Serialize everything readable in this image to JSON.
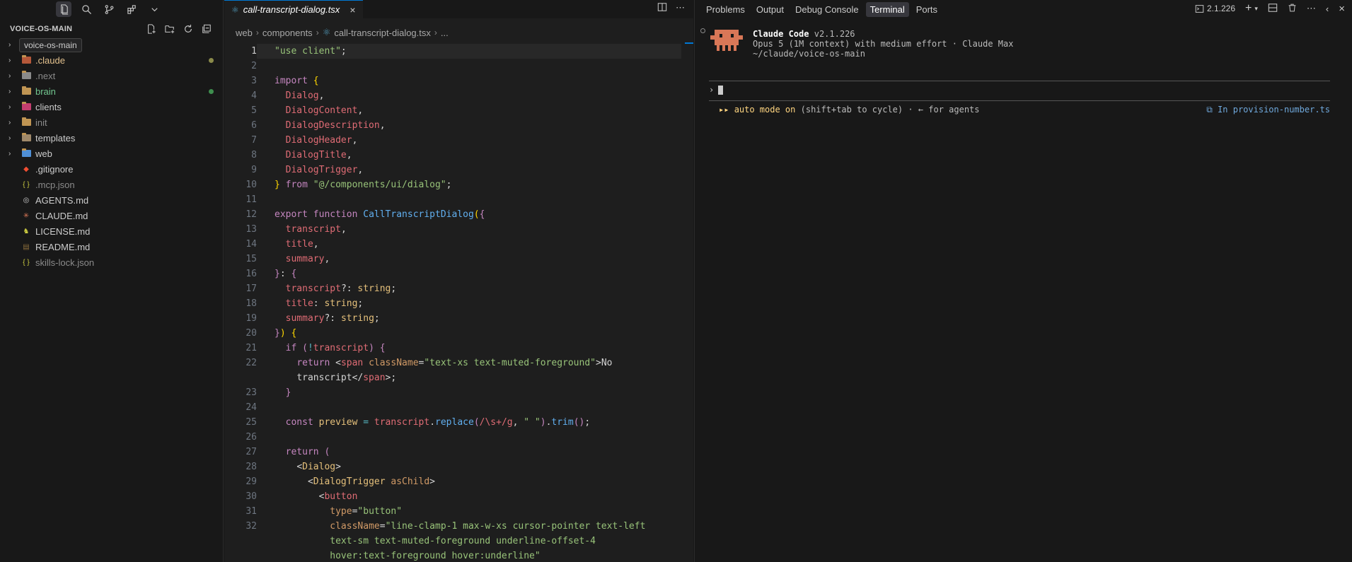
{
  "sidebar": {
    "title": "VOICE-OS-MAIN",
    "tooltip": "voice-os-main",
    "items": [
      {
        "label": "",
        "color": "#cccccc",
        "type": "folder",
        "icon": "folder-icon"
      },
      {
        "label": ".claude",
        "color": "#e2c08d",
        "type": "folder",
        "icon": "claude-folder-icon",
        "dot": "#8a8a4a"
      },
      {
        "label": ".next",
        "color": "#8b8b8b",
        "type": "folder",
        "icon": "next-folder-icon"
      },
      {
        "label": "brain",
        "color": "#73c991",
        "type": "folder",
        "icon": "folder-icon",
        "dot": "#3e8e4e"
      },
      {
        "label": "clients",
        "color": "#cccccc",
        "type": "folder",
        "icon": "clients-folder-icon"
      },
      {
        "label": "init",
        "color": "#8b8b8b",
        "type": "folder",
        "icon": "folder-icon"
      },
      {
        "label": "templates",
        "color": "#cccccc",
        "type": "folder",
        "icon": "templates-folder-icon"
      },
      {
        "label": "web",
        "color": "#cccccc",
        "type": "folder",
        "icon": "web-folder-icon"
      },
      {
        "label": ".gitignore",
        "color": "#cccccc",
        "type": "file",
        "icon": "git-icon"
      },
      {
        "label": ".mcp.json",
        "color": "#8b8b8b",
        "type": "file",
        "icon": "json-icon"
      },
      {
        "label": "AGENTS.md",
        "color": "#cccccc",
        "type": "file",
        "icon": "agents-icon"
      },
      {
        "label": "CLAUDE.md",
        "color": "#cccccc",
        "type": "file",
        "icon": "claude-asterisk-icon"
      },
      {
        "label": "LICENSE.md",
        "color": "#cccccc",
        "type": "file",
        "icon": "license-icon"
      },
      {
        "label": "README.md",
        "color": "#cccccc",
        "type": "file",
        "icon": "readme-icon"
      },
      {
        "label": "skills-lock.json",
        "color": "#8b8b8b",
        "type": "file",
        "icon": "json-icon"
      }
    ]
  },
  "editor": {
    "tab_label": "call-transcript-dialog.tsx",
    "breadcrumb": [
      "web",
      "components",
      "call-transcript-dialog.tsx",
      "..."
    ]
  },
  "code_lines": [
    {
      "n": "1",
      "html": "<span class='s'>\"use client\"</span><span class='p'>;</span>"
    },
    {
      "n": "2",
      "html": ""
    },
    {
      "n": "3",
      "html": "<span class='k'>import</span> <span class='b1'>{</span>"
    },
    {
      "n": "4",
      "html": "  <span class='v'>Dialog</span><span class='p'>,</span>"
    },
    {
      "n": "5",
      "html": "  <span class='v'>DialogContent</span><span class='p'>,</span>"
    },
    {
      "n": "6",
      "html": "  <span class='v'>DialogDescription</span><span class='p'>,</span>"
    },
    {
      "n": "7",
      "html": "  <span class='v'>DialogHeader</span><span class='p'>,</span>"
    },
    {
      "n": "8",
      "html": "  <span class='v'>DialogTitle</span><span class='p'>,</span>"
    },
    {
      "n": "9",
      "html": "  <span class='v'>DialogTrigger</span><span class='p'>,</span>"
    },
    {
      "n": "10",
      "html": "<span class='b1'>}</span> <span class='k'>from</span> <span class='s'>\"@/components/ui/dialog\"</span><span class='p'>;</span>"
    },
    {
      "n": "11",
      "html": ""
    },
    {
      "n": "12",
      "html": "<span class='k'>export</span> <span class='k'>function</span> <span class='fn'>CallTranscriptDialog</span><span class='b1'>(</span><span class='k'>{</span>"
    },
    {
      "n": "13",
      "html": "  <span class='v'>transcript</span><span class='p'>,</span>"
    },
    {
      "n": "14",
      "html": "  <span class='v'>title</span><span class='p'>,</span>"
    },
    {
      "n": "15",
      "html": "  <span class='v'>summary</span><span class='p'>,</span>"
    },
    {
      "n": "16",
      "html": "<span class='k'>}</span><span class='p'>:</span> <span class='k'>{</span>"
    },
    {
      "n": "17",
      "html": "  <span class='v'>transcript</span><span class='p'>?:</span> <span class='t'>string</span><span class='p'>;</span>"
    },
    {
      "n": "18",
      "html": "  <span class='v'>title</span><span class='p'>:</span> <span class='t'>string</span><span class='p'>;</span>"
    },
    {
      "n": "19",
      "html": "  <span class='v'>summary</span><span class='p'>?:</span> <span class='t'>string</span><span class='p'>;</span>"
    },
    {
      "n": "20",
      "html": "<span class='k'>}</span><span class='b1'>)</span> <span class='b1'>{</span>"
    },
    {
      "n": "21",
      "html": "  <span class='k'>if</span> <span class='k'>(</span><span class='o'>!</span><span class='v'>transcript</span><span class='k'>)</span> <span class='k'>{</span>"
    },
    {
      "n": "22",
      "html": "    <span class='k'>return</span> <span class='p'>&lt;</span><span class='tag'>span</span> <span class='attr'>className</span><span class='p'>=</span><span class='s'>\"text-xs text-muted-foreground\"</span><span class='p'>&gt;No</span>"
    },
    {
      "n": "",
      "html": "    <span class='p'>transcript&lt;/</span><span class='tag'>span</span><span class='p'>&gt;;</span>"
    },
    {
      "n": "23",
      "html": "  <span class='k'>}</span>"
    },
    {
      "n": "24",
      "html": ""
    },
    {
      "n": "25",
      "html": "  <span class='k'>const</span> <span class='t'>preview</span> <span class='o'>=</span> <span class='v'>transcript</span><span class='p'>.</span><span class='fn'>replace</span><span class='k'>(</span><span class='re'>/\\s+/g</span><span class='p'>,</span> <span class='s'>\" \"</span><span class='k'>)</span><span class='p'>.</span><span class='fn'>trim</span><span class='k'>()</span><span class='p'>;</span>"
    },
    {
      "n": "26",
      "html": ""
    },
    {
      "n": "27",
      "html": "  <span class='k'>return</span> <span class='k'>(</span>"
    },
    {
      "n": "28",
      "html": "    <span class='p'>&lt;</span><span class='t'>Dialog</span><span class='p'>&gt;</span>"
    },
    {
      "n": "29",
      "html": "      <span class='p'>&lt;</span><span class='t'>DialogTrigger</span> <span class='attr'>asChild</span><span class='p'>&gt;</span>"
    },
    {
      "n": "30",
      "html": "        <span class='p'>&lt;</span><span class='tag'>button</span>"
    },
    {
      "n": "31",
      "html": "          <span class='attr'>type</span><span class='p'>=</span><span class='s'>\"button\"</span>"
    },
    {
      "n": "32",
      "html": "          <span class='attr'>className</span><span class='p'>=</span><span class='s'>\"line-clamp-1 max-w-xs cursor-pointer text-left</span>"
    },
    {
      "n": "",
      "html": "          <span class='s'>text-sm text-muted-foreground underline-offset-4</span>"
    },
    {
      "n": "",
      "html": "          <span class='s'>hover:text-foreground hover:underline\"</span>"
    }
  ],
  "panel": {
    "tabs": [
      "Problems",
      "Output",
      "Debug Console",
      "Terminal",
      "Ports"
    ],
    "active_tab": "Terminal",
    "version_label": "2.1.226"
  },
  "terminal": {
    "app_name": "Claude Code",
    "version": "v2.1.226",
    "model_line": "Opus 5 (1M context) with medium effort · Claude Max",
    "path": "~/claude/voice-os-main",
    "prompt_symbol": "›",
    "mode_arrows": "▸▸",
    "mode_label": "auto mode on",
    "mode_hint": "(shift+tab to cycle) · ← for agents",
    "context_file": "⧉ In provision-number.ts"
  }
}
